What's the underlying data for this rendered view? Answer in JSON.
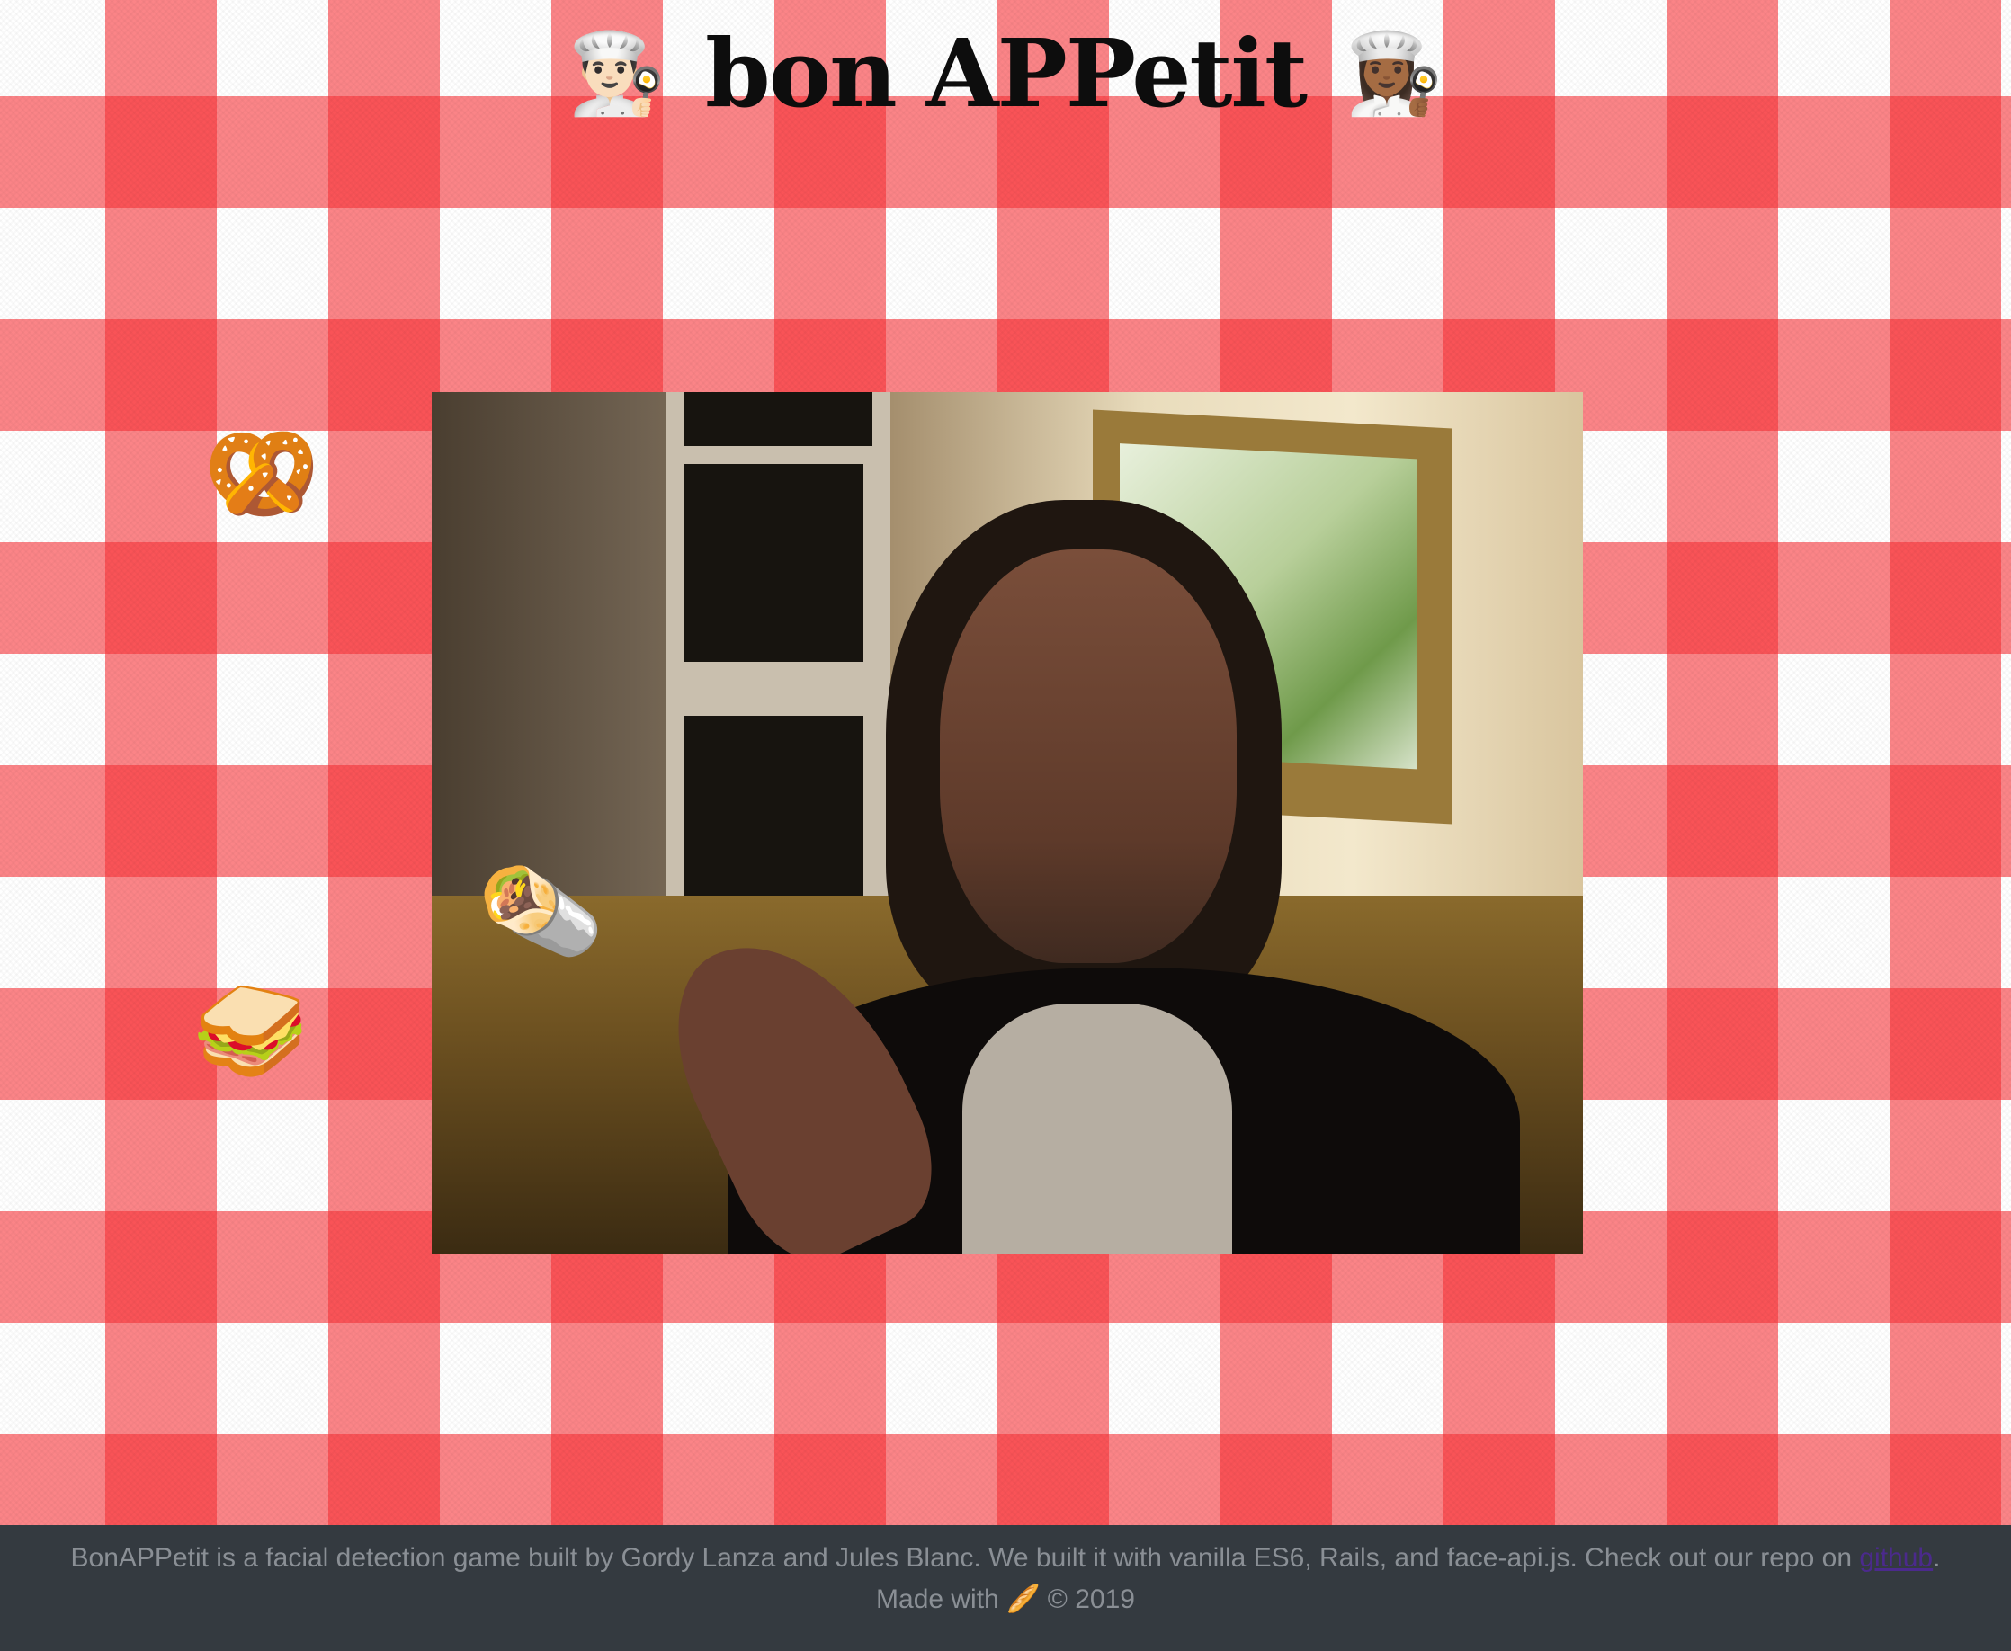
{
  "header": {
    "title": "bon APPetit",
    "left_icon": "👨🏻‍🍳",
    "right_icon": "👩🏾‍🍳"
  },
  "game": {
    "webcam_label": "webcam-feed",
    "foods": [
      {
        "name": "pretzel",
        "glyph": "🥨"
      },
      {
        "name": "burrito",
        "glyph": "🌯"
      },
      {
        "name": "sandwich",
        "glyph": "🥪"
      }
    ]
  },
  "footer": {
    "description": "BonAPPetit is a facial detection game built by Gordy Lanza and Jules Blanc. We built it with vanilla ES6, Rails, and face-api.js. Check out our repo on ",
    "link_text": "github",
    "end_punct": ".",
    "made_with": "Made with",
    "made_with_icon": "🥖",
    "copyright": "© 2019"
  },
  "colors": {
    "gingham_red": "#f83237",
    "footer_bg": "#343a40",
    "footer_text": "#8a8f95",
    "link": "#4b2a8c"
  }
}
